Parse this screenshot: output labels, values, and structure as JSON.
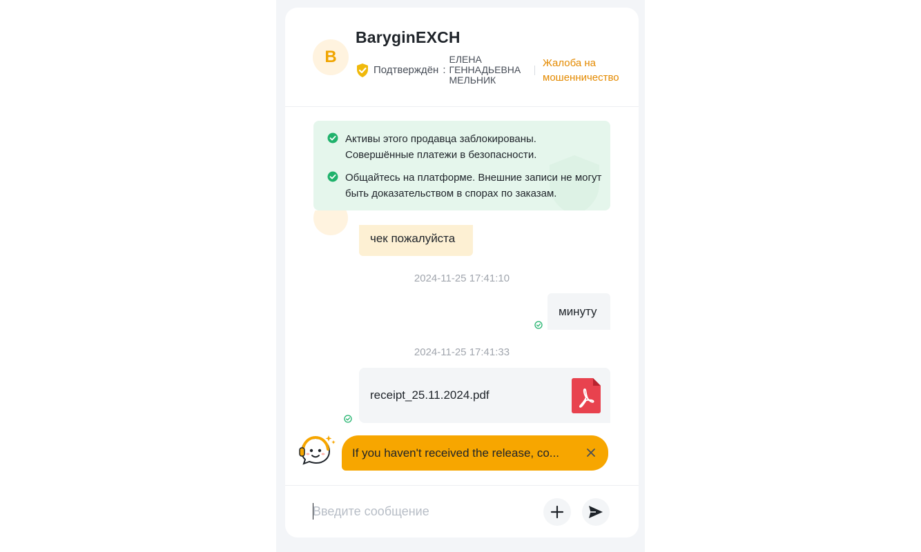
{
  "header": {
    "avatar_letter": "B",
    "seller_name": "BaryginEXCH",
    "verified_label": "Подтверждён",
    "verified_separator": ":",
    "real_name_lines": [
      "ЕЛЕНА",
      "ГЕННАДЬЕВНА",
      "МЕЛЬНИК"
    ],
    "report_link": "Жалоба на мошенничество"
  },
  "notice": {
    "items": [
      "Активы этого продавца заблокированы. Совершённые платежи в безопасности.",
      "Общайтесь на платформе. Внешние записи не могут быть доказательством в спорах по заказам."
    ]
  },
  "messages": {
    "incoming_text": "чек пожалуйста",
    "timestamp_1": "2024-11-25 17:41:10",
    "outgoing_text": "минуту",
    "timestamp_2": "2024-11-25 17:41:33",
    "file_name": "receipt_25.11.2024.pdf"
  },
  "bot": {
    "text": "If you haven't received the release, co..."
  },
  "composer": {
    "placeholder": "Введите сообщение"
  },
  "colors": {
    "accent": "#f7a600",
    "link": "#e48a00",
    "notice_bg": "#e5f6ec",
    "success": "#20b26c",
    "pdf": "#e8424e"
  },
  "icons": {
    "verified": "shield-check-icon",
    "notice_check": "check-circle-icon",
    "pdf": "pdf-file-icon",
    "bot": "support-bot-icon",
    "close": "close-icon",
    "add": "plus-icon",
    "send": "send-icon",
    "sent_status": "sent-check-icon"
  }
}
